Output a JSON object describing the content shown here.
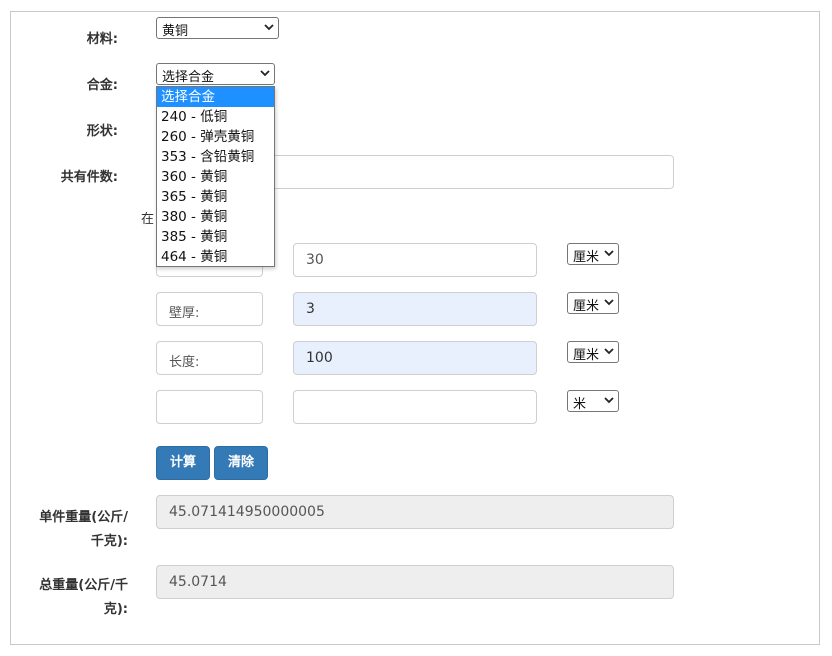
{
  "labels": {
    "material": "材料:",
    "alloy": "合金:",
    "shape": "形状:",
    "count": "共有件数:",
    "unit_weight_line1": "单件重量(公斤/",
    "unit_weight_line2": "千克):",
    "total_weight_line1": "总重量(公斤/千",
    "total_weight_line2": "克):"
  },
  "material_select": {
    "value": "黄铜"
  },
  "alloy_select": {
    "value": "选择合金",
    "options": [
      "选择合金",
      "240 - 低铜",
      "260 - 弹壳黄铜",
      "353 - 含铅黄铜",
      "360 - 黄铜",
      "365 - 黄铜",
      "380 - 黄铜",
      "385 - 黄铜",
      "464 - 黄铜"
    ],
    "highlighted_index": 0
  },
  "count_field": {
    "value": ""
  },
  "partial_hint": "在",
  "dimensions": [
    {
      "label": "",
      "value": "30",
      "unit": "厘米"
    },
    {
      "label": "壁厚:",
      "value": "3",
      "unit": "厘米"
    },
    {
      "label": "长度:",
      "value": "100",
      "unit": "厘米"
    },
    {
      "label": "",
      "value": "",
      "unit": "米"
    }
  ],
  "buttons": {
    "calculate": "计算",
    "clear": "清除"
  },
  "results": {
    "unit_weight": "45.071414950000005",
    "total_weight": "45.0714"
  }
}
